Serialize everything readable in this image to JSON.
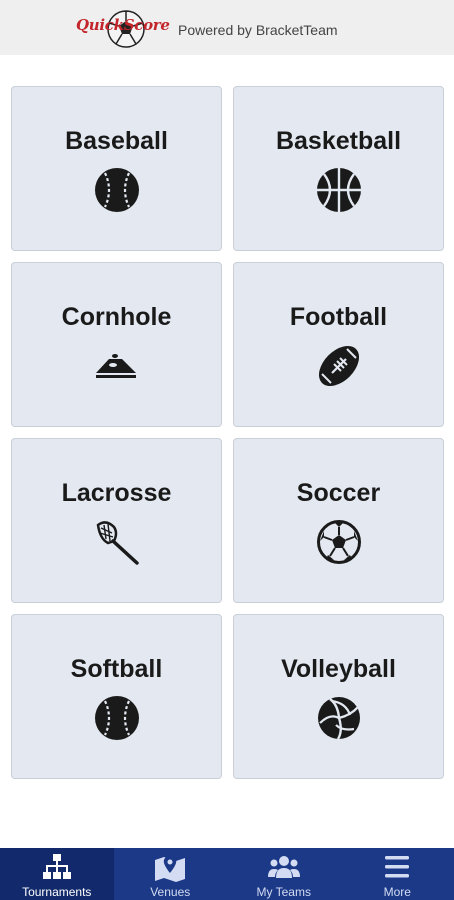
{
  "header": {
    "logo_text": "QuickScore",
    "powered_by": "Powered by BracketTeam",
    "brand_color": "#c3252b"
  },
  "sports": [
    {
      "label": "Baseball",
      "icon": "baseball-icon"
    },
    {
      "label": "Basketball",
      "icon": "basketball-icon"
    },
    {
      "label": "Cornhole",
      "icon": "cornhole-icon"
    },
    {
      "label": "Football",
      "icon": "football-icon"
    },
    {
      "label": "Lacrosse",
      "icon": "lacrosse-icon"
    },
    {
      "label": "Soccer",
      "icon": "soccer-icon"
    },
    {
      "label": "Softball",
      "icon": "softball-icon"
    },
    {
      "label": "Volleyball",
      "icon": "volleyball-icon"
    }
  ],
  "tabbar": {
    "background": "#1c3988",
    "active_background": "#122a6b",
    "tabs": [
      {
        "label": "Tournaments",
        "icon": "bracket-icon",
        "active": true
      },
      {
        "label": "Venues",
        "icon": "map-pin-icon",
        "active": false
      },
      {
        "label": "My Teams",
        "icon": "users-icon",
        "active": false
      },
      {
        "label": "More",
        "icon": "menu-icon",
        "active": false
      }
    ]
  }
}
